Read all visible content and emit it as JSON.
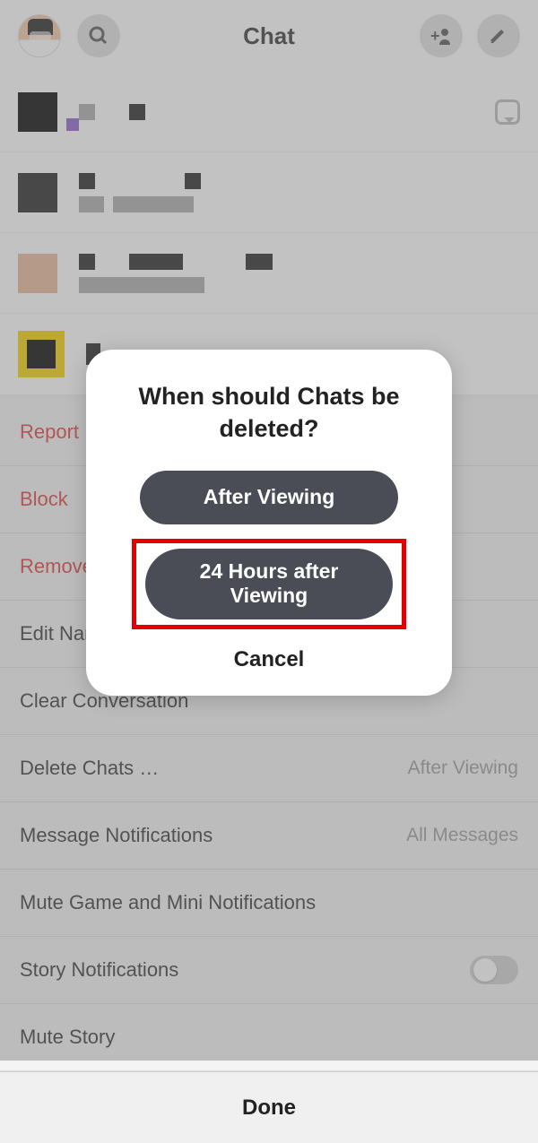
{
  "header": {
    "title": "Chat"
  },
  "settings": {
    "report": "Report",
    "block": "Block",
    "remove": "Remove Friend",
    "editName": "Edit Name",
    "clearConversation": "Clear Conversation",
    "deleteChats": "Delete Chats …",
    "deleteChatsValue": "After Viewing",
    "messageNotifications": "Message Notifications",
    "messageNotificationsValue": "All Messages",
    "muteGame": "Mute Game and Mini Notifications",
    "storyNotifications": "Story Notifications",
    "muteStory": "Mute Story",
    "done": "Done"
  },
  "modal": {
    "title": "When should Chats be deleted?",
    "option1": "After Viewing",
    "option2": "24 Hours after Viewing",
    "cancel": "Cancel"
  }
}
